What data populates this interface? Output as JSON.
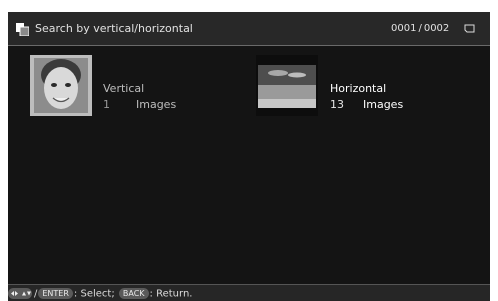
{
  "header": {
    "title": "Search by vertical/horizontal",
    "page_current": "0001",
    "page_total": "0002"
  },
  "groups": [
    {
      "label": "Vertical",
      "count": "1",
      "unit": "Images",
      "selected": false
    },
    {
      "label": "Horizontal",
      "count": "13",
      "unit": "Images",
      "selected": true
    }
  ],
  "footer": {
    "enter_key": "ENTER",
    "select_text": ": Select;",
    "back_key": "BACK",
    "return_text": ": Return."
  },
  "icons": [
    "search-mode-icon",
    "memory-card-icon",
    "arrow-keys-icon"
  ]
}
